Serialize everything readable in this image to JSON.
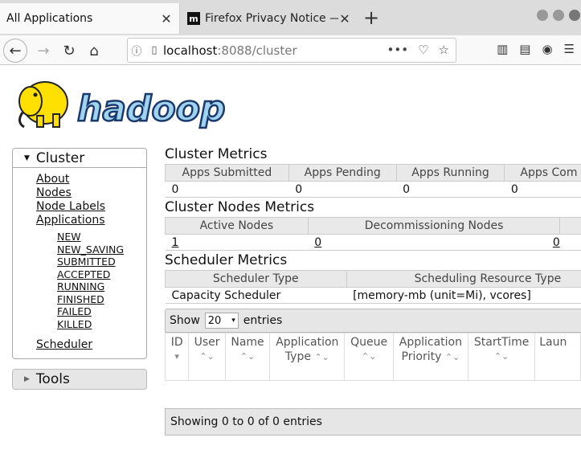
{
  "browser": {
    "tabs": [
      {
        "title": "All Applications",
        "active": true
      },
      {
        "title": "Firefox Privacy Notice —",
        "active": false
      }
    ],
    "url_host": "localhost",
    "url_rest": ":8088/cluster"
  },
  "logo_text": "hadoop",
  "sidebar": {
    "cluster_title": "Cluster",
    "links": [
      "About",
      "Nodes",
      "Node Labels",
      "Applications"
    ],
    "app_states": [
      "NEW",
      "NEW_SAVING",
      "SUBMITTED",
      "ACCEPTED",
      "RUNNING",
      "FINISHED",
      "FAILED",
      "KILLED"
    ],
    "scheduler": "Scheduler",
    "tools_title": "Tools"
  },
  "cluster_metrics": {
    "title": "Cluster Metrics",
    "headers": [
      "Apps Submitted",
      "Apps Pending",
      "Apps Running",
      "Apps Com"
    ],
    "values": [
      "0",
      "0",
      "0",
      "0"
    ]
  },
  "nodes_metrics": {
    "title": "Cluster Nodes Metrics",
    "headers": [
      "Active Nodes",
      "Decommissioning Nodes"
    ],
    "values": [
      "1",
      "0",
      "0"
    ]
  },
  "scheduler_metrics": {
    "title": "Scheduler Metrics",
    "headers": [
      "Scheduler Type",
      "Scheduling Resource Type"
    ],
    "values": [
      "Capacity Scheduler",
      "[memory-mb (unit=Mi), vcores]"
    ]
  },
  "apps_table": {
    "show_label": "Show",
    "entries_value": "20",
    "entries_label": "entries",
    "columns": [
      {
        "line1": "ID",
        "line2": ""
      },
      {
        "line1": "User",
        "line2": ""
      },
      {
        "line1": "Name",
        "line2": ""
      },
      {
        "line1": "Application",
        "line2": "Type"
      },
      {
        "line1": "Queue",
        "line2": ""
      },
      {
        "line1": "Application",
        "line2": "Priority"
      },
      {
        "line1": "StartTime",
        "line2": ""
      },
      {
        "line1": "Laun",
        "line2": ""
      }
    ],
    "footer": "Showing 0 to 0 of 0 entries"
  }
}
